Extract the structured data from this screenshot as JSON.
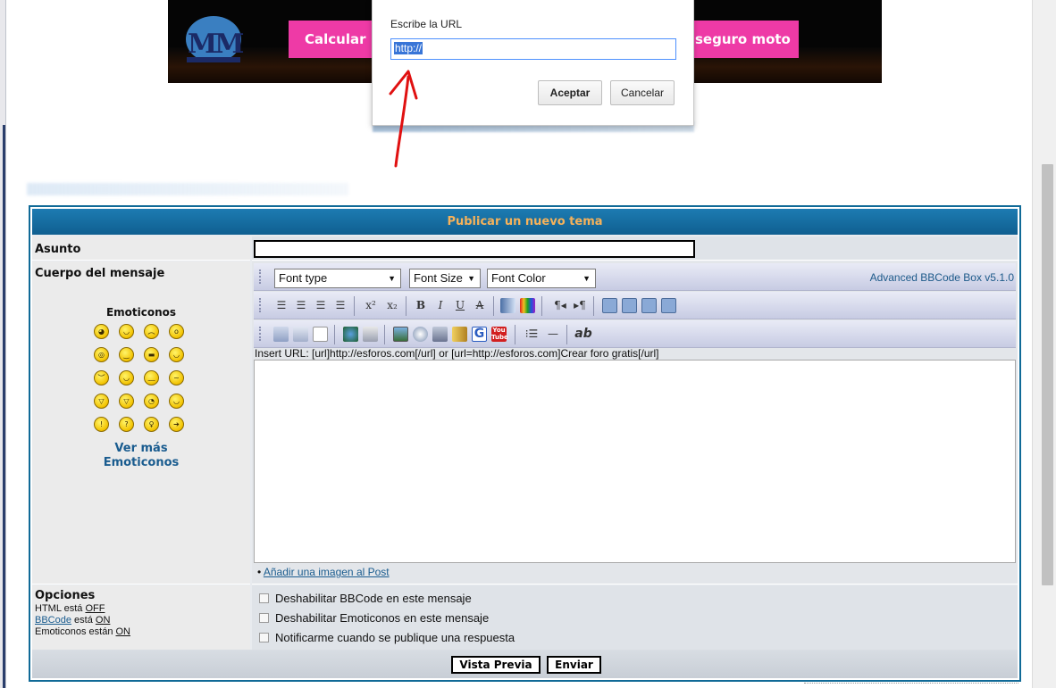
{
  "banner": {
    "logo_text": "MM",
    "cta_left": "Calcular p",
    "cta_right": "seguro moto"
  },
  "dialog": {
    "prompt": "Escribe la URL",
    "input_value": "http://",
    "ok_label": "Aceptar",
    "cancel_label": "Cancelar"
  },
  "form": {
    "header": "Publicar un nuevo tema",
    "subject_label": "Asunto",
    "subject_value": "",
    "body_label": "Cuerpo del mensaje",
    "emoticons_title": "Emoticonos",
    "emoticons": [
      {
        "icon": "grin-icon",
        "g": "◕"
      },
      {
        "icon": "smile-icon",
        "g": "◡"
      },
      {
        "icon": "sad-icon",
        "g": "︵"
      },
      {
        "icon": "surprised-icon",
        "g": "o"
      },
      {
        "icon": "confused-icon",
        "g": "◎"
      },
      {
        "icon": "neutral-icon",
        "g": "‿"
      },
      {
        "icon": "cool-icon",
        "g": "▬"
      },
      {
        "icon": "laugh-icon",
        "g": "◡"
      },
      {
        "icon": "angry-icon",
        "g": "︶"
      },
      {
        "icon": "tongue-icon",
        "g": "◡"
      },
      {
        "icon": "blush-icon",
        "g": "﹏"
      },
      {
        "icon": "unsure-icon",
        "g": "~"
      },
      {
        "icon": "evil-icon",
        "g": "▽"
      },
      {
        "icon": "twisted-icon",
        "g": "▽"
      },
      {
        "icon": "rolleyes-icon",
        "g": "◔"
      },
      {
        "icon": "wink-icon",
        "g": "◡"
      },
      {
        "icon": "exclaim-icon",
        "g": "!"
      },
      {
        "icon": "question-icon",
        "g": "?"
      },
      {
        "icon": "idea-icon",
        "g": "♀"
      },
      {
        "icon": "arrow-icon",
        "g": "➔"
      }
    ],
    "more_emoticons_line1": "Ver más",
    "more_emoticons_line2": "Emoticonos",
    "font_type": "Font type",
    "font_size": "Font Size",
    "font_color": "Font Color",
    "bbcode_version": "Advanced BBCode Box v5.1.0",
    "hint": "Insert URL: [url]http://esforos.com[/url] or [url=http://esforos.com]Crear foro gratis[/url]",
    "add_image": "Añadir una imagen al Post",
    "options_label": "Opciones",
    "html_state_prefix": "HTML está ",
    "html_state": "OFF",
    "bbcode_link": "BBCode",
    "bbcode_state_prefix": " está ",
    "bbcode_state": "ON",
    "emoticons_state_prefix": "Emoticonos están ",
    "emoticons_state": "ON",
    "option_disable_bbcode": "Deshabilitar BBCode en este mensaje",
    "option_disable_emoticons": "Deshabilitar Emoticonos en este mensaje",
    "option_notify": "Notificarme cuando se publique una respuesta",
    "preview_button": "Vista Previa",
    "submit_button": "Enviar"
  },
  "colors": {
    "header_bg": "#0f5f90",
    "header_text": "#f6b25a",
    "link": "#1a5c8f",
    "arrow": "#e01010"
  }
}
